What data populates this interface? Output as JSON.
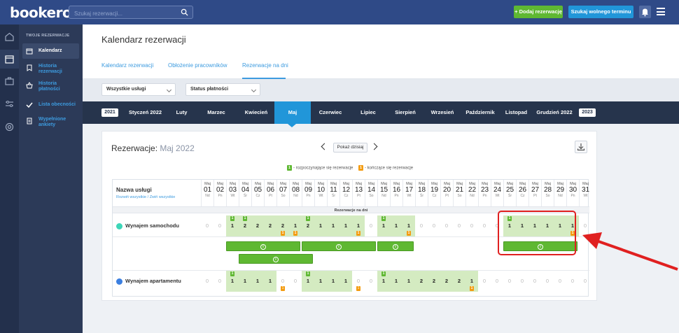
{
  "header": {
    "logo": "bookero",
    "search_placeholder": "Szukaj rezerwacji...",
    "add_button": "+ Dodaj rezerwację",
    "find_button": "Szukaj wolnego terminu"
  },
  "sidebar": {
    "section_title": "TWOJE REZERWACJE",
    "items": [
      {
        "label": "Kalendarz",
        "icon": "calendar-icon"
      },
      {
        "label": "Historia rezerwacji",
        "icon": "bookmark-icon"
      },
      {
        "label": "Historia płatności",
        "icon": "basket-icon"
      },
      {
        "label": "Lista obecności",
        "icon": "check-icon"
      },
      {
        "label": "Wypełnione ankiety",
        "icon": "document-icon"
      }
    ]
  },
  "page": {
    "title": "Kalendarz rezerwacji",
    "tabs": [
      "Kalendarz rezerwacji",
      "Obłożenie pracowników",
      "Rezerwacje na dni"
    ]
  },
  "filters": {
    "service": "Wszystkie usługi",
    "payment": "Status płatności"
  },
  "months": {
    "year_prev": "2021",
    "year_next": "2023",
    "items": [
      "Styczeń 2022",
      "Luty",
      "Marzec",
      "Kwiecień",
      "Maj",
      "Czerwiec",
      "Lipiec",
      "Sierpień",
      "Wrzesień",
      "Październik",
      "Listopad",
      "Grudzień 2022"
    ],
    "active": "Maj"
  },
  "calendar": {
    "title_prefix": "Rezerwacje:",
    "title_month": "Maj 2022",
    "today_button": "Pokaż dzisiaj",
    "legend_start": "- rozpoczynające się rezerwacje",
    "legend_end": "- kończące się rezerwacje",
    "legend_badge": "1",
    "services_header": "Nazwa usługi",
    "expand_all": "Rozwiń wszystkie",
    "separator": "/",
    "collapse_all": "Zwiń wszystkie",
    "subheader": "Rezerwacje na dni",
    "month_abbr": "Maj",
    "days": [
      "01",
      "02",
      "03",
      "04",
      "05",
      "06",
      "07",
      "08",
      "09",
      "10",
      "11",
      "12",
      "13",
      "14",
      "15",
      "16",
      "17",
      "18",
      "19",
      "20",
      "21",
      "22",
      "23",
      "24",
      "25",
      "26",
      "27",
      "28",
      "29",
      "30",
      "31"
    ],
    "weekdays": [
      "Nd",
      "Pn",
      "Wt",
      "Śr",
      "Cz",
      "Pt",
      "So",
      "Nd",
      "Pn",
      "Wt",
      "Śr",
      "Cz",
      "Pt",
      "So",
      "Nd",
      "Pn",
      "Wt",
      "Śr",
      "Cz",
      "Pt",
      "So",
      "Nd",
      "Pn",
      "Wt",
      "Śr",
      "Cz",
      "Pt",
      "So",
      "Nd",
      "Pn",
      "Wt"
    ],
    "rows": [
      {
        "name": "Wynajem samochodu",
        "color": "#3dd6b8",
        "counts": [
          0,
          0,
          1,
          2,
          2,
          2,
          2,
          1,
          2,
          1,
          1,
          1,
          1,
          0,
          1,
          1,
          1,
          0,
          0,
          0,
          0,
          0,
          0,
          0,
          1,
          1,
          1,
          1,
          1,
          1,
          0
        ],
        "starts": [
          3,
          4,
          9,
          15,
          25
        ],
        "ends": [
          7,
          8,
          13,
          17,
          30
        ]
      },
      {
        "name": "Wynajem apartamentu",
        "color": "#3b7fe0",
        "counts": [
          0,
          0,
          1,
          1,
          1,
          1,
          0,
          0,
          1,
          1,
          1,
          1,
          0,
          0,
          1,
          1,
          1,
          2,
          2,
          2,
          2,
          1,
          0,
          0,
          0,
          0,
          0,
          0,
          0,
          0,
          0
        ],
        "starts": [
          3,
          9,
          15
        ],
        "ends": [
          7,
          13,
          22
        ]
      }
    ],
    "info_glyph": "i"
  },
  "colors": {
    "topbar": "#2f4a87",
    "accent_blue": "#2196d9",
    "start_badge": "#5fb832",
    "end_badge": "#f39c12",
    "highlight": "#e02020"
  }
}
